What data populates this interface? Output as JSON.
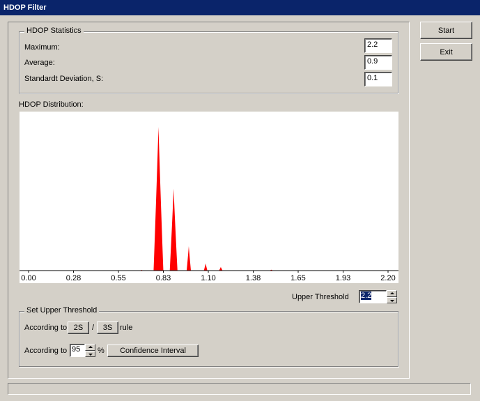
{
  "window": {
    "title": "HDOP Filter"
  },
  "buttons": {
    "start": "Start",
    "exit": "Exit"
  },
  "statistics": {
    "group_title": "HDOP Statistics",
    "maximum_label": "Maximum:",
    "maximum_value": "2.2",
    "average_label": "Average:",
    "average_value": "0.9",
    "stddev_label": "Standardt Deviation, S:",
    "stddev_value": "0.1"
  },
  "distribution": {
    "label": "HDOP Distribution:"
  },
  "threshold": {
    "label": "Upper Threshold",
    "value": "2.2"
  },
  "set_threshold": {
    "group_title": "Set Upper Threshold",
    "according_to_1": "According to",
    "btn_2s": "2S",
    "slash": "/",
    "btn_3s": "3S",
    "rule": "rule",
    "according_to_2": "According to",
    "percent_value": "95",
    "percent_sign": "%",
    "confidence_button": "Confidence Interval"
  },
  "colors": {
    "bars": "#ff0000",
    "titlebar": "#0a246a"
  },
  "chart_data": {
    "type": "bar",
    "xlim": [
      0.0,
      2.2
    ],
    "xticks": [
      "0.00",
      "0.28",
      "0.55",
      "0.83",
      "1.10",
      "1.38",
      "1.65",
      "1.93",
      "2.20"
    ],
    "ylim": [
      0,
      100
    ],
    "peaks": [
      {
        "x": 0.7,
        "y": 0.5
      },
      {
        "x": 0.8,
        "y": 100
      },
      {
        "x": 0.89,
        "y": 57
      },
      {
        "x": 0.98,
        "y": 17
      },
      {
        "x": 1.08,
        "y": 5
      },
      {
        "x": 1.17,
        "y": 2.5
      },
      {
        "x": 1.47,
        "y": 0.6
      }
    ]
  }
}
